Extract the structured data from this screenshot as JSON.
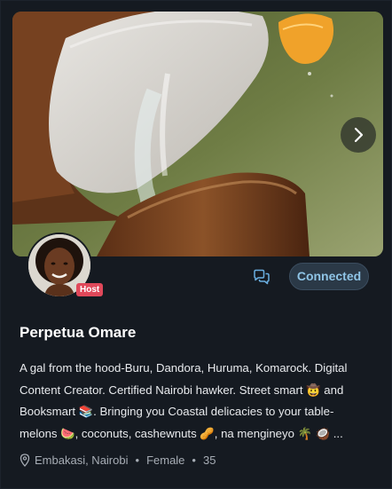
{
  "profile": {
    "name": "Perpetua Omare",
    "badge": "Host",
    "connect_label": "Connected",
    "bio_lines": [
      "A gal from the hood-Buru, Dandora, Huruma, Komarock. Digital",
      "Content Creator. Certified Nairobi hawker. Street smart 🤠 and",
      "Booksmart 📚. Bringing you Coastal delicacies to your table-",
      "melons 🍉, coconuts, cashewnuts 🥜, na mengineyo 🌴 🥥 ..."
    ],
    "location": "Embakasi, Nairobi",
    "gender": "Female",
    "age": "35",
    "separator": "•"
  },
  "icons": {
    "next": "chevron-right-icon",
    "chat": "chat-bubbles-icon",
    "location": "location-pin-icon"
  },
  "colors": {
    "card_bg": "#151a21",
    "accent": "#8fc4e6",
    "badge": "#e0485a"
  }
}
